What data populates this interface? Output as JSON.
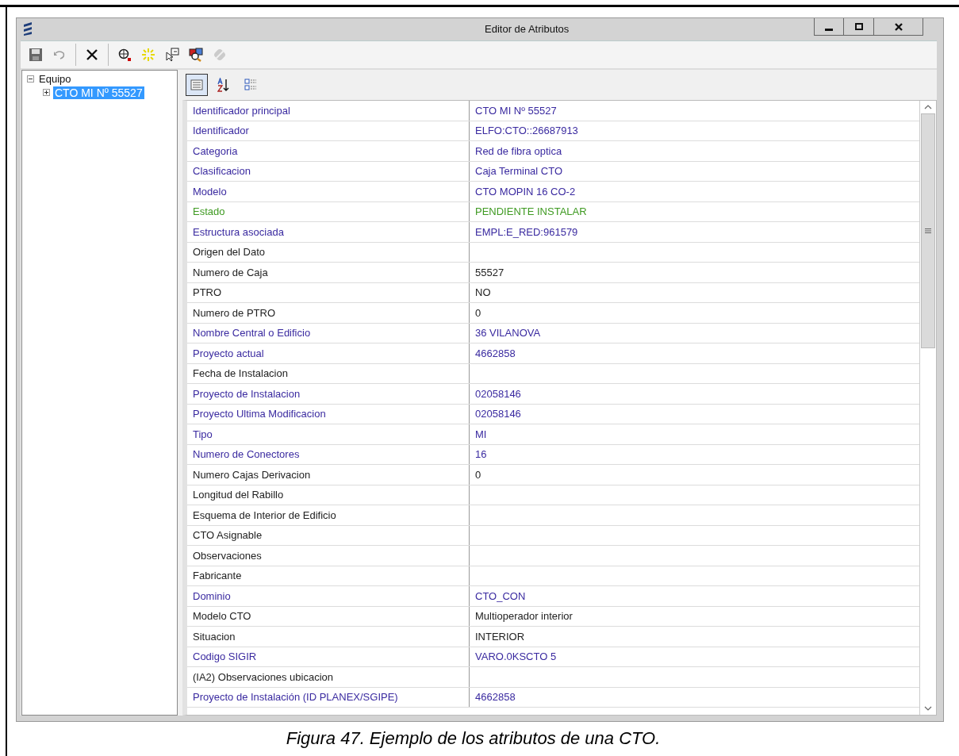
{
  "window": {
    "title": "Editor de Atributos"
  },
  "toolbar": [
    {
      "kind": "save",
      "disabled": false
    },
    {
      "kind": "undo",
      "disabled": true
    },
    {
      "kind": "delete",
      "disabled": false
    },
    {
      "kind": "locate",
      "disabled": false
    },
    {
      "kind": "highlight",
      "disabled": false
    },
    {
      "kind": "pointer",
      "disabled": false
    },
    {
      "kind": "inspect",
      "disabled": false
    },
    {
      "kind": "link",
      "disabled": true
    }
  ],
  "tree": [
    {
      "label": "Equipo",
      "expanded": true,
      "selected": false,
      "children": [
        {
          "label": "CTO MI Nº 55527",
          "expanded": false,
          "selected": true
        }
      ]
    }
  ],
  "grid_toolbar": [
    {
      "kind": "categorized",
      "selected": true
    },
    {
      "kind": "alphabetical",
      "selected": false
    },
    {
      "kind": "pages",
      "selected": false
    }
  ],
  "attributes": [
    {
      "name": "Identificador principal",
      "value": "CTO MI Nº 55527",
      "color": "#3a2aa0"
    },
    {
      "name": "Identificador",
      "value": "ELFO:CTO::26687913",
      "color": "#3a2aa0"
    },
    {
      "name": "Categoria",
      "value": "Red de fibra optica",
      "color": "#3a2aa0"
    },
    {
      "name": "Clasificacion",
      "value": "Caja Terminal CTO",
      "color": "#3a2aa0"
    },
    {
      "name": "Modelo",
      "value": "CTO MOPIN 16 CO-2",
      "color": "#3a2aa0"
    },
    {
      "name": "Estado",
      "value": "PENDIENTE INSTALAR",
      "color": "#3f9a22"
    },
    {
      "name": "Estructura asociada",
      "value": "EMPL:E_RED:961579",
      "color": "#3a2aa0"
    },
    {
      "name": "Origen del Dato",
      "color": "#222222"
    },
    {
      "name": "Numero de Caja",
      "value": "55527",
      "color": "#222222"
    },
    {
      "name": "PTRO",
      "value": "NO",
      "color": "#222222"
    },
    {
      "name": "Numero de PTRO",
      "value": "0",
      "color": "#222222"
    },
    {
      "name": "Nombre Central o Edificio",
      "value": "36 VILANOVA",
      "color": "#3a2aa0"
    },
    {
      "name": "Proyecto actual",
      "value": "4662858",
      "color": "#3a2aa0"
    },
    {
      "name": "Fecha de Instalacion",
      "color": "#222222"
    },
    {
      "name": "Proyecto de Instalacion",
      "value": "02058146",
      "color": "#3a2aa0"
    },
    {
      "name": "Proyecto Ultima Modificacion",
      "value": "02058146",
      "color": "#3a2aa0"
    },
    {
      "name": "Tipo",
      "value": "MI",
      "color": "#3a2aa0"
    },
    {
      "name": "Numero de Conectores",
      "value": "16",
      "color": "#3a2aa0"
    },
    {
      "name": "Numero Cajas Derivacion",
      "value": "0",
      "color": "#222222"
    },
    {
      "name": "Longitud del Rabillo",
      "color": "#222222"
    },
    {
      "name": "Esquema de Interior de Edificio",
      "color": "#222222"
    },
    {
      "name": "CTO Asignable",
      "color": "#222222"
    },
    {
      "name": "Observaciones",
      "color": "#222222"
    },
    {
      "name": "Fabricante",
      "color": "#222222"
    },
    {
      "name": "Dominio",
      "value": "CTO_CON",
      "color": "#3a2aa0"
    },
    {
      "name": "Modelo CTO",
      "value": "Multioperador interior",
      "color": "#222222"
    },
    {
      "name": "Situacion",
      "value": "INTERIOR",
      "color": "#222222"
    },
    {
      "name": "Codigo SIGIR",
      "value": "VARO.0KSCTO 5",
      "color": "#3a2aa0"
    },
    {
      "name": "(IA2) Observaciones ubicacion",
      "color": "#222222"
    },
    {
      "name": "Proyecto de Instalación (ID PLANEX/SGIPE)",
      "value": "4662858",
      "color": "#3a2aa0"
    }
  ],
  "caption": "Figura 47. Ejemplo de los atributos de una CTO."
}
